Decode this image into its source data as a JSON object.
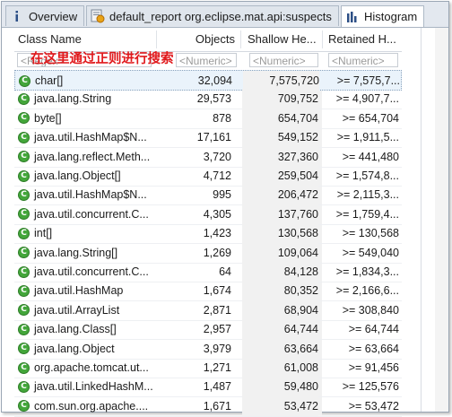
{
  "tabs": [
    {
      "label": "Overview",
      "icon": "info-icon"
    },
    {
      "label": "default_report  org.eclipse.mat.api:suspects",
      "icon": "report-icon"
    },
    {
      "label": "Histogram",
      "icon": "histogram-icon",
      "active": true
    }
  ],
  "columns": {
    "name": "Class Name",
    "objects": "Objects",
    "shallow": "Shallow He...",
    "retained": "Retained H..."
  },
  "filter": {
    "name_placeholder": "<Regex>",
    "objects_placeholder": "<Numeric>",
    "shallow_placeholder": "<Numeric>",
    "retained_placeholder": "<Numeric>",
    "annotation": "在这里通过正则进行搜索"
  },
  "rows": [
    {
      "name": "char[]",
      "objects": "32,094",
      "shallow": "7,575,720",
      "retained": ">= 7,575,7..."
    },
    {
      "name": "java.lang.String",
      "objects": "29,573",
      "shallow": "709,752",
      "retained": ">= 4,907,7..."
    },
    {
      "name": "byte[]",
      "objects": "878",
      "shallow": "654,704",
      "retained": ">= 654,704"
    },
    {
      "name": "java.util.HashMap$N...",
      "objects": "17,161",
      "shallow": "549,152",
      "retained": ">= 1,911,5..."
    },
    {
      "name": "java.lang.reflect.Meth...",
      "objects": "3,720",
      "shallow": "327,360",
      "retained": ">= 441,480"
    },
    {
      "name": "java.lang.Object[]",
      "objects": "4,712",
      "shallow": "259,504",
      "retained": ">= 1,574,8..."
    },
    {
      "name": "java.util.HashMap$N...",
      "objects": "995",
      "shallow": "206,472",
      "retained": ">= 2,115,3..."
    },
    {
      "name": "java.util.concurrent.C...",
      "objects": "4,305",
      "shallow": "137,760",
      "retained": ">= 1,759,4..."
    },
    {
      "name": "int[]",
      "objects": "1,423",
      "shallow": "130,568",
      "retained": ">= 130,568"
    },
    {
      "name": "java.lang.String[]",
      "objects": "1,269",
      "shallow": "109,064",
      "retained": ">= 549,040"
    },
    {
      "name": "java.util.concurrent.C...",
      "objects": "64",
      "shallow": "84,128",
      "retained": ">= 1,834,3..."
    },
    {
      "name": "java.util.HashMap",
      "objects": "1,674",
      "shallow": "80,352",
      "retained": ">= 2,166,6..."
    },
    {
      "name": "java.util.ArrayList",
      "objects": "2,871",
      "shallow": "68,904",
      "retained": ">= 308,840"
    },
    {
      "name": "java.lang.Class[]",
      "objects": "2,957",
      "shallow": "64,744",
      "retained": ">= 64,744"
    },
    {
      "name": "java.lang.Object",
      "objects": "3,979",
      "shallow": "63,664",
      "retained": ">= 63,664"
    },
    {
      "name": "org.apache.tomcat.ut...",
      "objects": "1,271",
      "shallow": "61,008",
      "retained": ">= 91,456"
    },
    {
      "name": "java.util.LinkedHashM...",
      "objects": "1,487",
      "shallow": "59,480",
      "retained": ">= 125,576"
    },
    {
      "name": "com.sun.org.apache....",
      "objects": "1,671",
      "shallow": "53,472",
      "retained": ">= 53,472"
    }
  ],
  "colors": {
    "class_icon": "#43a63a",
    "annotation": "#e0181b",
    "selection": "#eaf3fb"
  }
}
